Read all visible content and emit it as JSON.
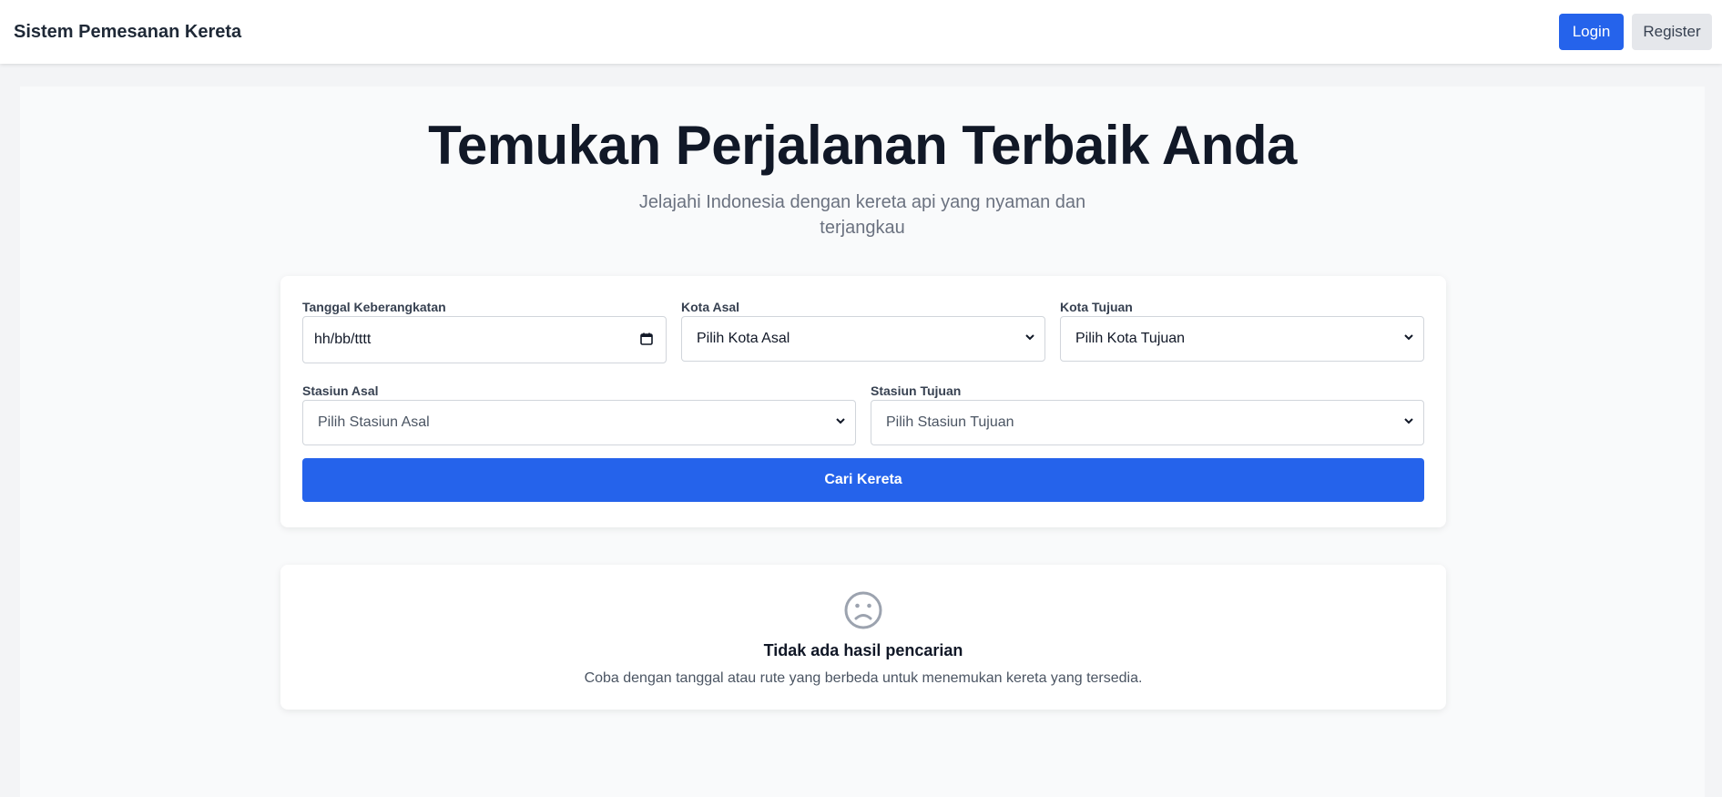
{
  "navbar": {
    "brand": "Sistem Pemesanan Kereta",
    "login_label": "Login",
    "register_label": "Register"
  },
  "hero": {
    "title": "Temukan Perjalanan Terbaik Anda",
    "subtitle": "Jelajahi Indonesia dengan kereta api yang nyaman dan terjangkau"
  },
  "search_form": {
    "date": {
      "label": "Tanggal Keberangkatan",
      "value": "hh/bb/tttt",
      "icon": "calendar-icon"
    },
    "origin_city": {
      "label": "Kota Asal",
      "selected": "Pilih Kota Asal"
    },
    "destination_city": {
      "label": "Kota Tujuan",
      "selected": "Pilih Kota Tujuan"
    },
    "origin_station": {
      "label": "Stasiun Asal",
      "selected": "Pilih Stasiun Asal"
    },
    "destination_station": {
      "label": "Stasiun Tujuan",
      "selected": "Pilih Stasiun Tujuan"
    },
    "submit_label": "Cari Kereta"
  },
  "results": {
    "icon": "sad-face-icon",
    "empty_title": "Tidak ada hasil pencarian",
    "empty_description": "Coba dengan tanggal atau rute yang berbeda untuk menemukan kereta yang tersedia."
  },
  "colors": {
    "primary": "#2563eb",
    "background": "#f3f4f6",
    "text_dark": "#111827",
    "text_muted": "#6b7280"
  }
}
